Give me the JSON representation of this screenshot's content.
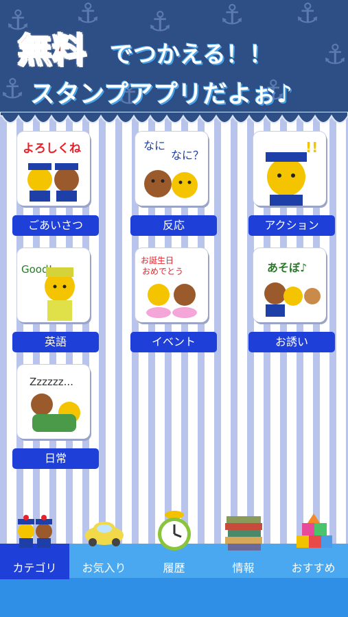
{
  "header": {
    "title_highlight": "無料",
    "title_line1_rest": "でつかえる！！",
    "title_line2": "スタンプアプリだよぉ♪"
  },
  "stamps": [
    {
      "label": "ごあいさつ",
      "art_text": "よろしくね♪"
    },
    {
      "label": "反応",
      "art_text": "なに なに？"
    },
    {
      "label": "アクション",
      "art_text": "!!"
    },
    {
      "label": "英語",
      "art_text": "Good!"
    },
    {
      "label": "イベント",
      "art_text": "お誕生日 おめでとう♪"
    },
    {
      "label": "お誘い",
      "art_text": "あそぼ♪"
    },
    {
      "label": "日常",
      "art_text": "Zzzzzz..."
    }
  ],
  "tabs": [
    {
      "label": "カテゴリ",
      "icon": "bears-icon",
      "active": true
    },
    {
      "label": "お気入り",
      "icon": "car-icon",
      "active": false
    },
    {
      "label": "履歴",
      "icon": "clock-icon",
      "active": false
    },
    {
      "label": "情報",
      "icon": "books-icon",
      "active": false
    },
    {
      "label": "おすすめ",
      "icon": "blocks-icon",
      "active": false
    }
  ],
  "colors": {
    "header_bg": "#2e4f85",
    "label_button": "#1e3fd8",
    "tabbar": "#4aa8f0",
    "tab_active": "#1e3fd8"
  }
}
